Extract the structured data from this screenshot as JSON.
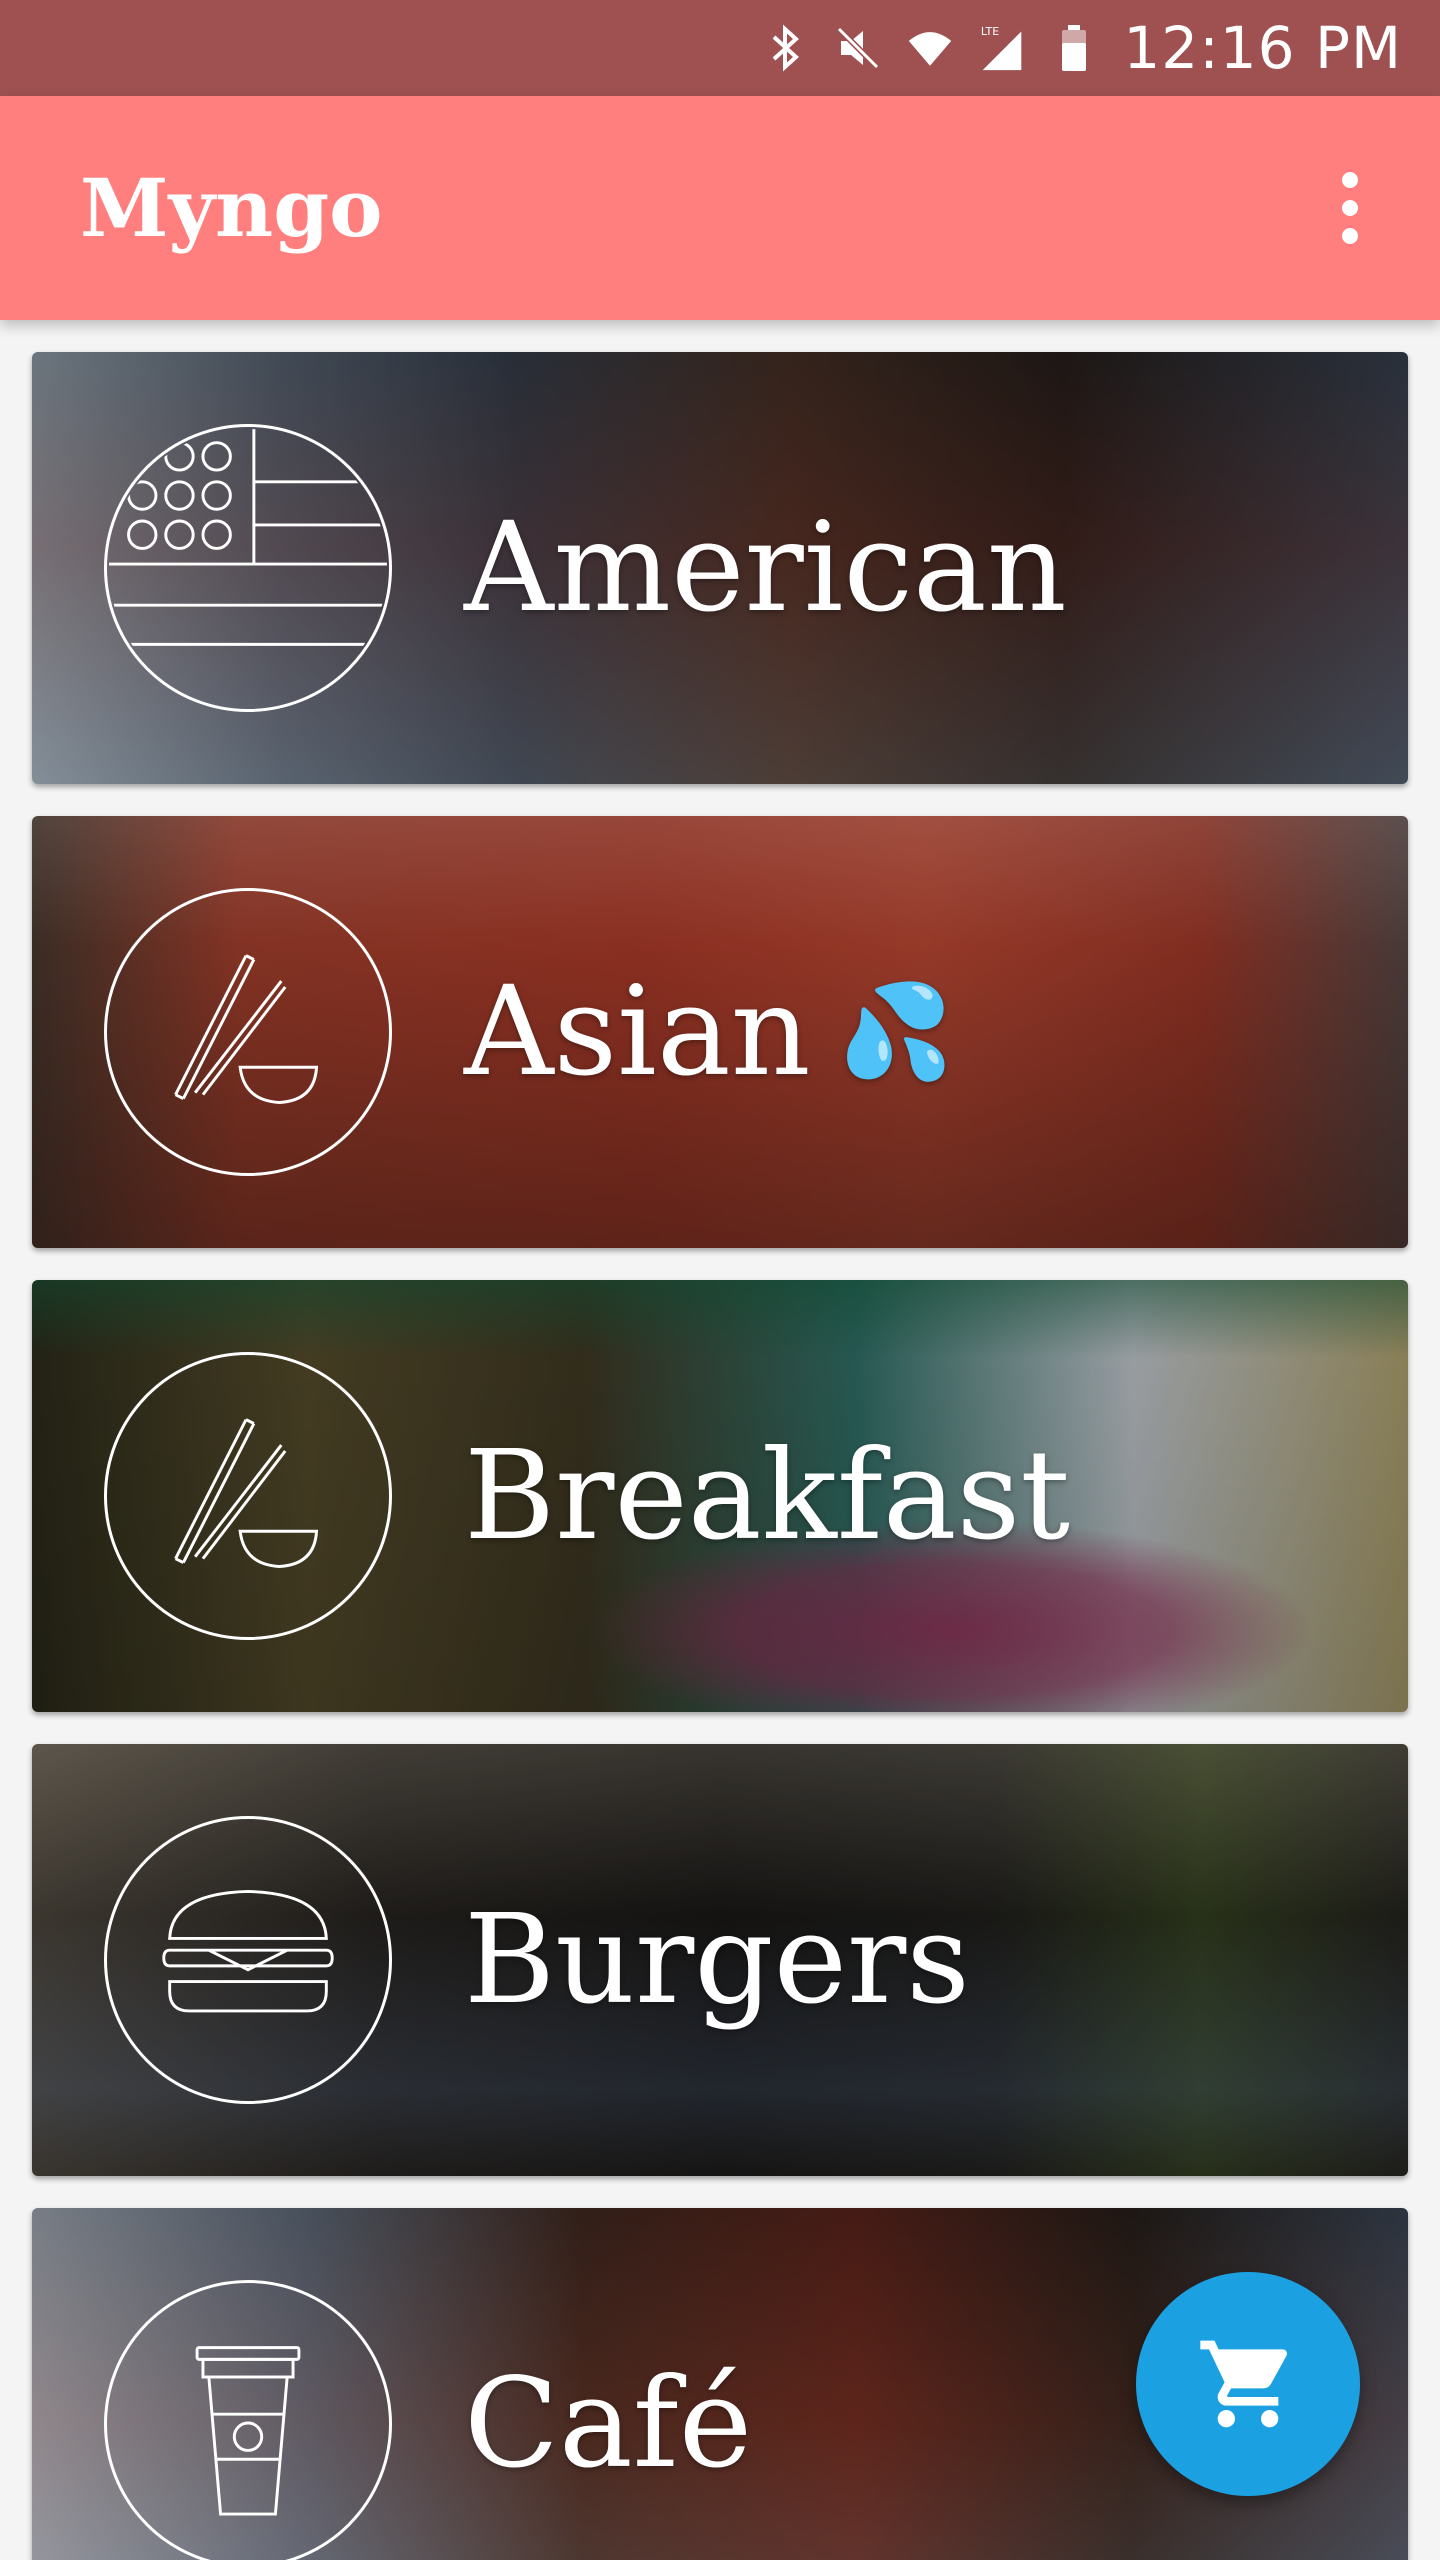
{
  "status_bar": {
    "time": "12:16 PM",
    "icons": [
      "bluetooth-icon",
      "mute-icon",
      "wifi-icon",
      "lte-signal-icon",
      "battery-icon"
    ],
    "color": "#9e5150"
  },
  "app_bar": {
    "title": "Myngo",
    "overflow_icon": "more-vert-icon",
    "color": "#ff7f7e"
  },
  "categories": [
    {
      "label": "American",
      "icon": "us-flag-icon"
    },
    {
      "label": "Asian",
      "icon": "chopsticks-bowl-icon",
      "emoji": "💦"
    },
    {
      "label": "Breakfast",
      "icon": "chopsticks-bowl-icon"
    },
    {
      "label": "Burgers",
      "icon": "burger-icon"
    },
    {
      "label": "Café",
      "icon": "coffee-cup-icon"
    }
  ],
  "fab": {
    "icon": "shopping-cart-icon",
    "color": "#1ba1e2"
  }
}
